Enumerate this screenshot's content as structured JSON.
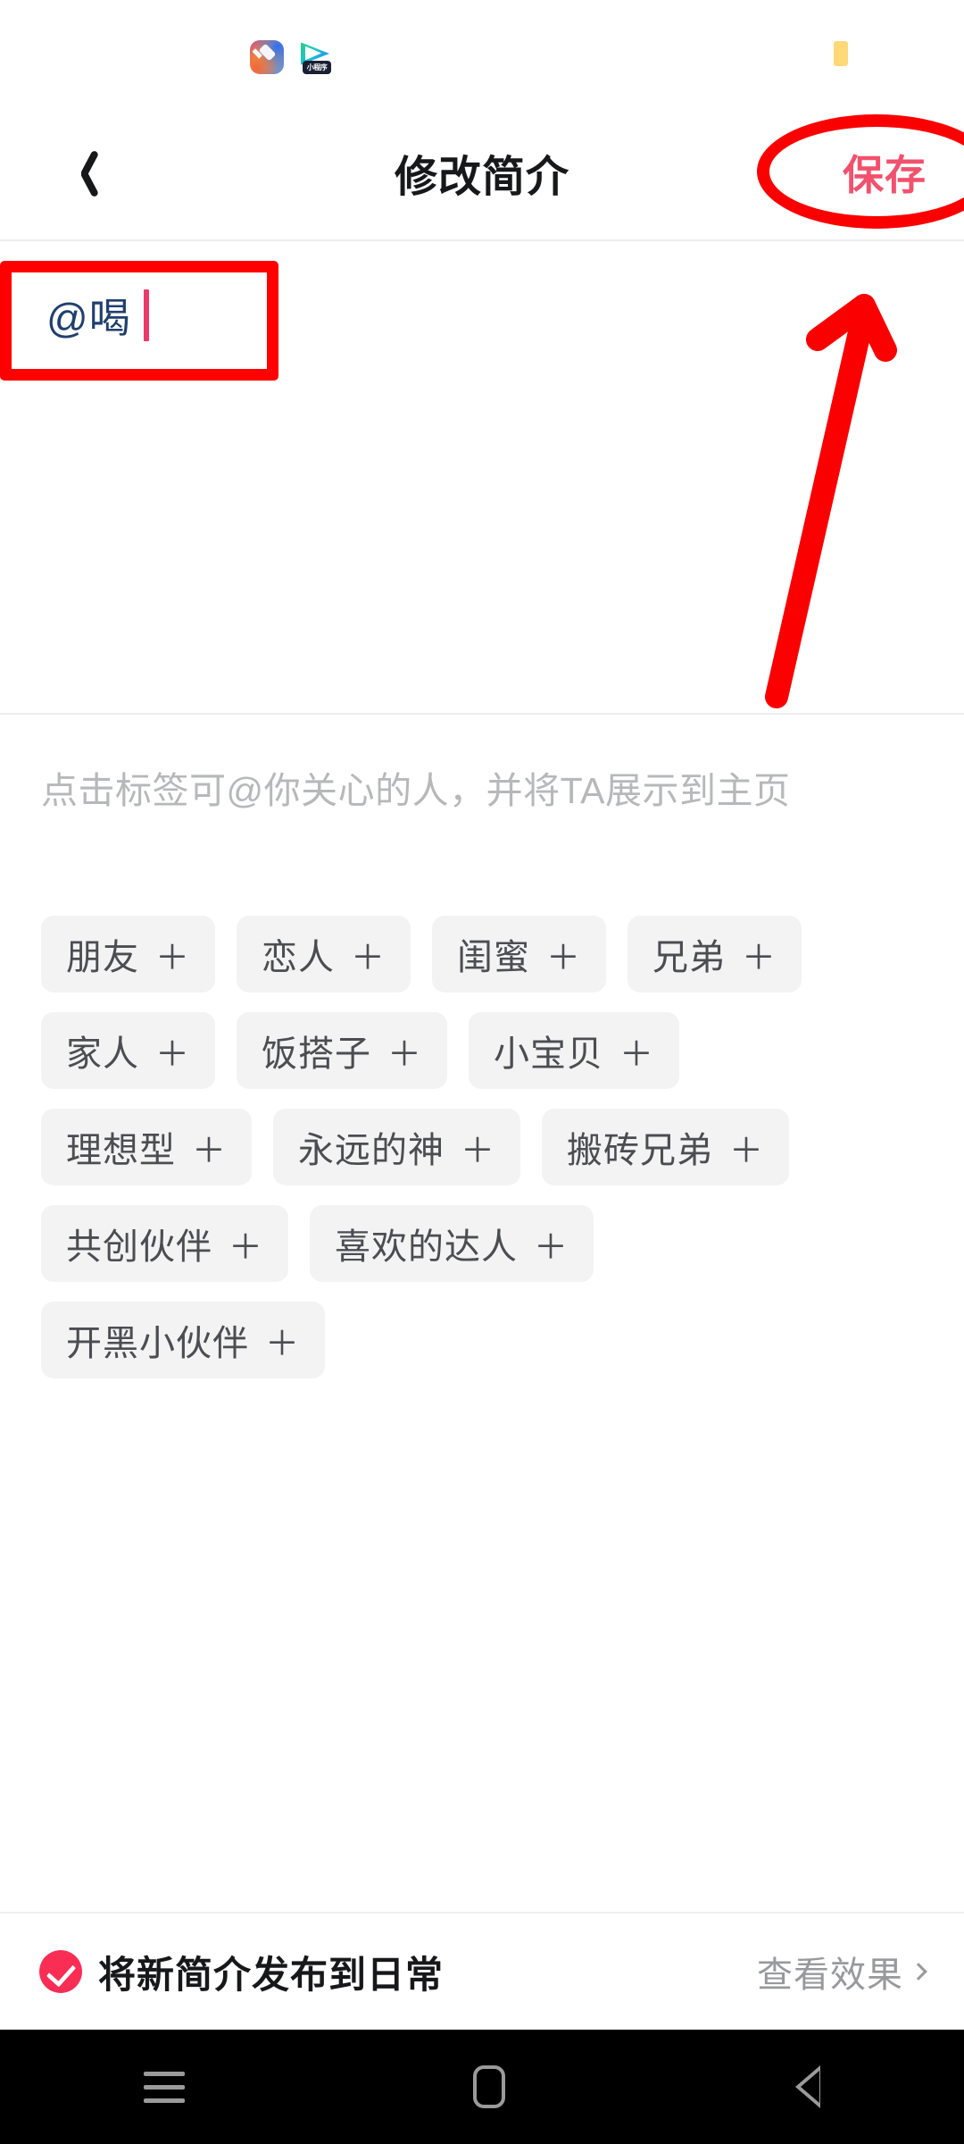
{
  "status_bar": {
    "app_icons": [
      {
        "name": "gradient-app-icon",
        "label": ""
      },
      {
        "name": "video-app-icon",
        "label": "小程序"
      }
    ],
    "right_indicator": {
      "name": "battery-indicator",
      "color": "#ffd877"
    }
  },
  "header": {
    "back_icon": "back-chevron-icon",
    "title": "修改简介",
    "save_label": "保存",
    "save_color": "#f2516d"
  },
  "editor": {
    "value": "@喝",
    "placeholder": "",
    "text_color": "#20406d",
    "caret_color": "#eb3a6a"
  },
  "hint": {
    "text": "点击标签可@你关心的人，并将TA展示到主页"
  },
  "tags": {
    "plus_glyph": "＋",
    "rows": [
      [
        {
          "label": "朋友"
        },
        {
          "label": "恋人"
        },
        {
          "label": "闺蜜"
        },
        {
          "label": "兄弟"
        }
      ],
      [
        {
          "label": "家人"
        },
        {
          "label": "饭搭子"
        },
        {
          "label": "小宝贝"
        }
      ],
      [
        {
          "label": "理想型"
        },
        {
          "label": "永远的神"
        },
        {
          "label": "搬砖兄弟"
        }
      ],
      [
        {
          "label": "共创伙伴"
        },
        {
          "label": "喜欢的达人"
        }
      ],
      [
        {
          "label": "开黑小伙伴"
        }
      ]
    ]
  },
  "bottom_bar": {
    "checkbox": {
      "name": "publish-checkbox",
      "checked": true,
      "color": "#fa2e55"
    },
    "publish_label": "将新简介发布到日常",
    "preview_label": "查看效果",
    "preview_chevron": "chevron-right-icon"
  },
  "nav_bar": {
    "recents": "recents-icon",
    "home": "home-icon",
    "back": "back-triangle-icon"
  },
  "annotations": {
    "rect_color": "#ff0000",
    "ellipse_color": "#fb0000",
    "arrow_color": "#fb0000"
  }
}
